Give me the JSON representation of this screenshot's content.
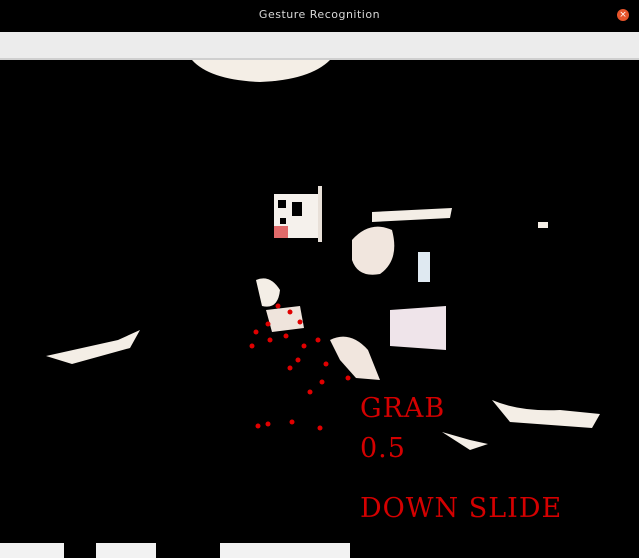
{
  "window": {
    "title": "Gesture Recognition",
    "close_icon": "close-icon"
  },
  "overlay": {
    "gesture": "GRAB",
    "confidence": "0.5",
    "action": "DOWN SLIDE",
    "color": "#d40000"
  },
  "colors": {
    "background": "#000000",
    "toolbar": "#ececec",
    "keypoint": "#e00000",
    "highlight": "#f4eee6"
  }
}
